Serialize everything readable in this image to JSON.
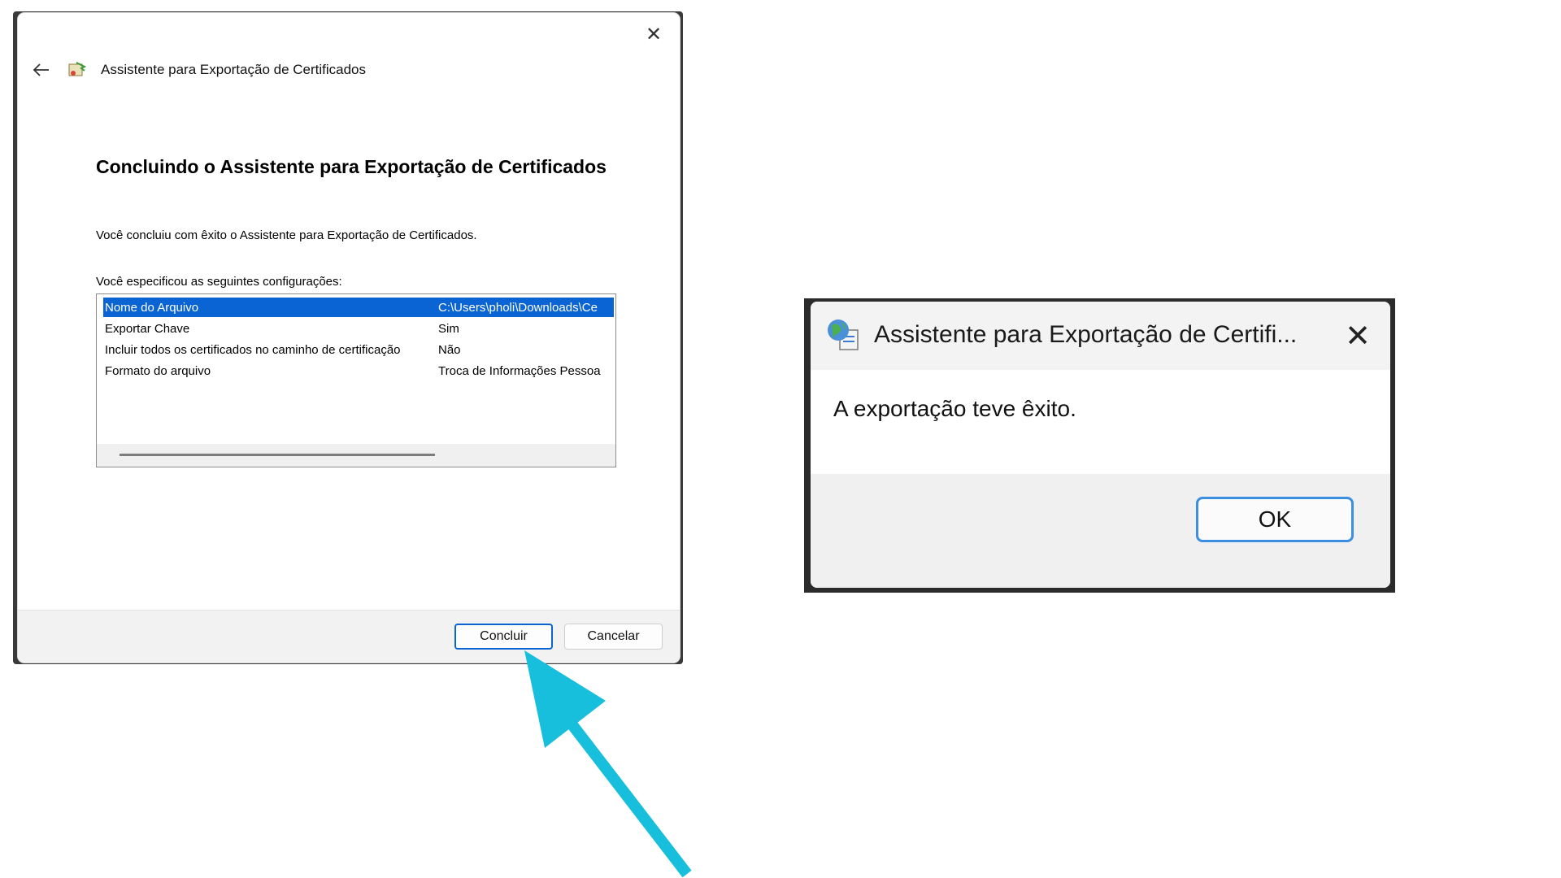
{
  "wizard": {
    "title": "Assistente para Exportação de Certificados",
    "heading": "Concluindo o Assistente para Exportação de Certificados",
    "message": "Você concluiu com êxito o Assistente para Exportação de Certificados.",
    "list_label": "Você especificou as seguintes configurações:",
    "settings": [
      {
        "key": "Nome do Arquivo",
        "value": "C:\\Users\\pholi\\Downloads\\Ce",
        "selected": true
      },
      {
        "key": "Exportar Chave",
        "value": "Sim",
        "selected": false
      },
      {
        "key": "Incluir todos os certificados no caminho de certificação",
        "value": "Não",
        "selected": false
      },
      {
        "key": "Formato do arquivo",
        "value": "Troca de Informações Pessoa",
        "selected": false
      }
    ],
    "buttons": {
      "finish": "Concluir",
      "cancel": "Cancelar"
    },
    "icons": {
      "back": "back-arrow-icon",
      "app": "certificate-wizard-icon",
      "close": "close-icon"
    }
  },
  "message_box": {
    "title": "Assistente para Exportação de Certifi...",
    "message": "A exportação teve êxito.",
    "ok_label": "OK",
    "icons": {
      "app": "certificate-globe-icon",
      "close": "close-icon"
    }
  },
  "annotation": {
    "color": "#17bfdc",
    "icon": "arrow-pointing-to-concluir"
  },
  "colors": {
    "selection": "#0a64d4",
    "ok_border": "#3b8fe0"
  }
}
